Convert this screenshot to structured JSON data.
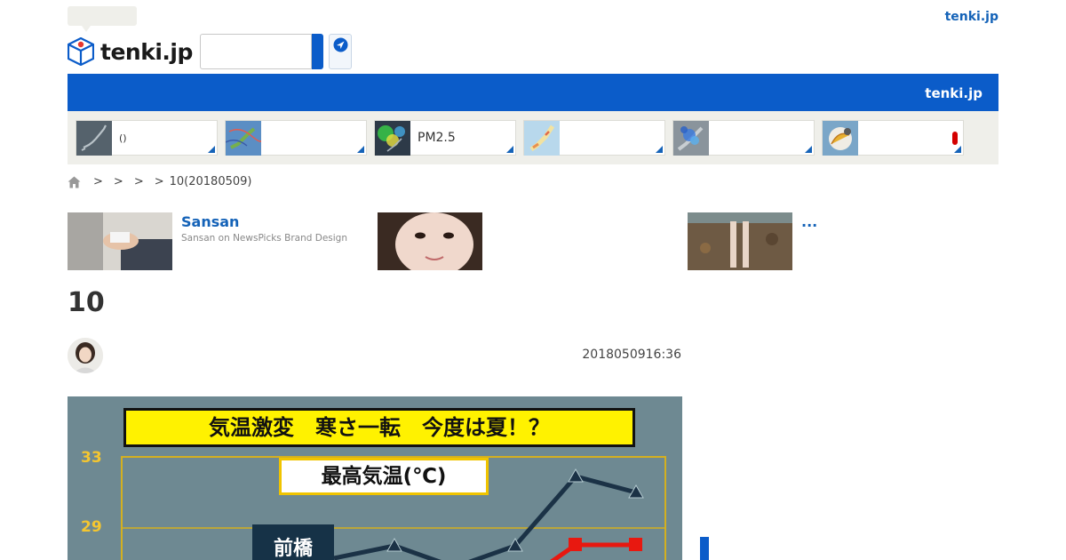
{
  "header": {
    "logo_text": "tenki.jp",
    "top_link": "tenki.jp",
    "bar_title": "tenki.jp",
    "search": {
      "value": "",
      "placeholder": ""
    }
  },
  "nav_tiles": [
    {
      "label": "()",
      "icon": "japan-map-thumbnail"
    },
    {
      "label": "",
      "icon": "weather-map-thumbnail"
    },
    {
      "label": "PM2.5",
      "icon": "pm25-map-thumbnail"
    },
    {
      "label": "",
      "icon": "warning-map-thumbnail"
    },
    {
      "label": "",
      "icon": "radar-map-thumbnail"
    },
    {
      "label": "",
      "icon": "umbrella-thumbnail"
    }
  ],
  "breadcrumb": {
    "items": [
      "",
      "",
      "",
      "10(20180509)"
    ],
    "separator": ">"
  },
  "ads": [
    {
      "title": "Sansan",
      "subtitle": "Sansan on NewsPicks Brand Design"
    },
    {
      "title": "",
      "subtitle": ""
    },
    {
      "title": "...",
      "subtitle": ""
    }
  ],
  "article": {
    "title": "10",
    "date": "2018050916:36",
    "hero": {
      "banner": "気温激変　寒さ一転　今度は夏！？",
      "subtitle": "最高気温(℃)",
      "y_ticks": [
        "33",
        "29"
      ],
      "city": "前橋"
    }
  },
  "colors": {
    "brand_blue": "#0b5cc9",
    "link_blue": "#1563b8",
    "tile_bg": "#efefea"
  }
}
